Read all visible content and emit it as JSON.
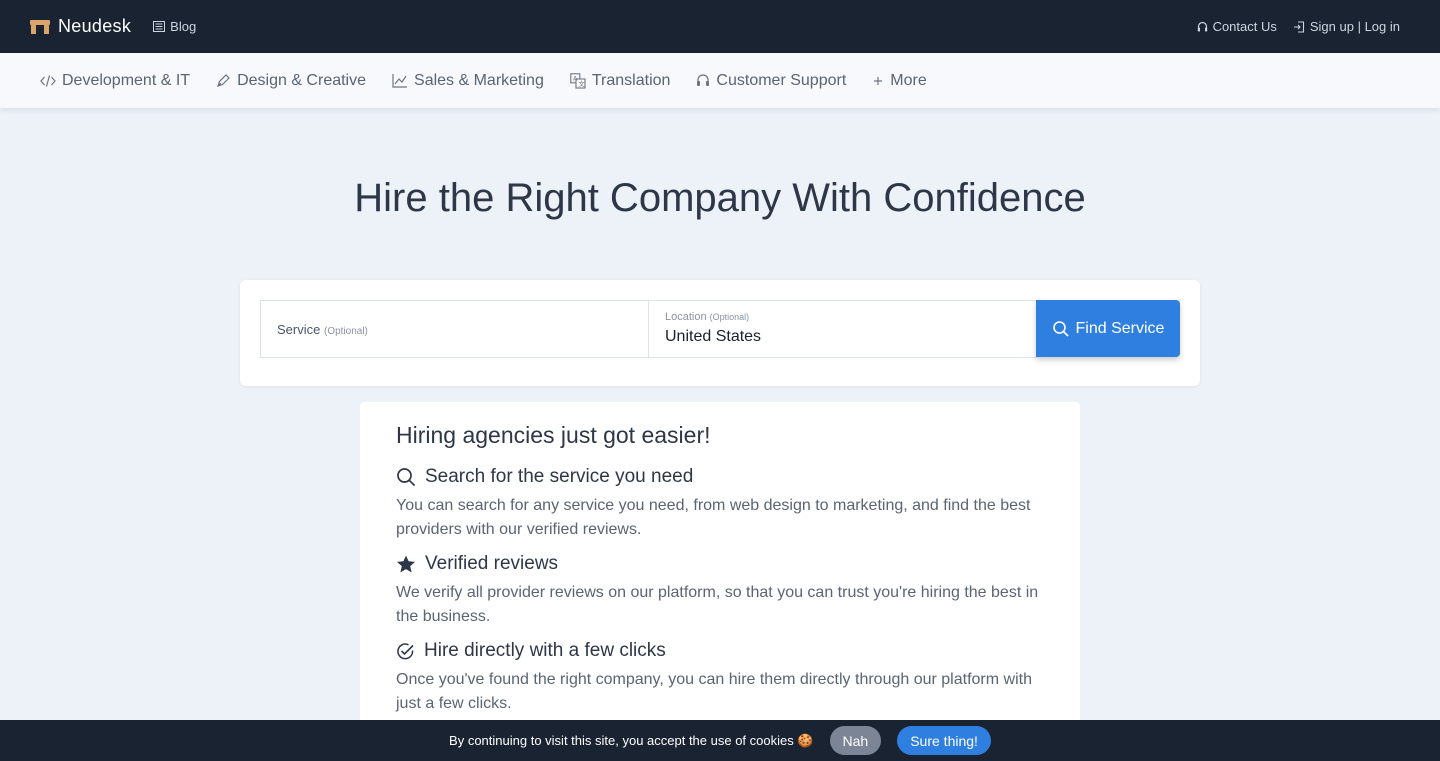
{
  "header": {
    "brand": "Neudesk",
    "blog": "Blog",
    "contact": "Contact Us",
    "signup": "Sign up | Log in"
  },
  "categories": [
    {
      "label": "Development & IT",
      "icon": "code-icon"
    },
    {
      "label": "Design & Creative",
      "icon": "pen-icon"
    },
    {
      "label": "Sales & Marketing",
      "icon": "chart-line-icon"
    },
    {
      "label": "Translation",
      "icon": "translate-icon"
    },
    {
      "label": "Customer Support",
      "icon": "headset-icon"
    },
    {
      "label": "More",
      "icon": "plus-icon"
    }
  ],
  "hero": {
    "title": "Hire the Right Company With Confidence"
  },
  "search": {
    "service_label": "Service",
    "service_optional": "(Optional)",
    "location_label": "Location",
    "location_optional": "(Optional)",
    "location_value": "United States",
    "button": "Find Service"
  },
  "info": {
    "heading": "Hiring agencies just got easier!",
    "features": [
      {
        "title": "Search for the service you need",
        "text": "You can search for any service you need, from web design to marketing, and find the best providers with our verified reviews.",
        "icon": "search-icon"
      },
      {
        "title": "Verified reviews",
        "text": "We verify all provider reviews on our platform, so that you can trust you're hiring the best in the business.",
        "icon": "star-icon"
      },
      {
        "title": "Hire directly with a few clicks",
        "text": "Once you've found the right company, you can hire them directly through our platform with just a few clicks.",
        "icon": "check-circle-icon"
      }
    ]
  },
  "cookie": {
    "message": "By continuing to visit this site, you accept the use of cookies 🍪",
    "decline": "Nah",
    "accept": "Sure thing!"
  }
}
